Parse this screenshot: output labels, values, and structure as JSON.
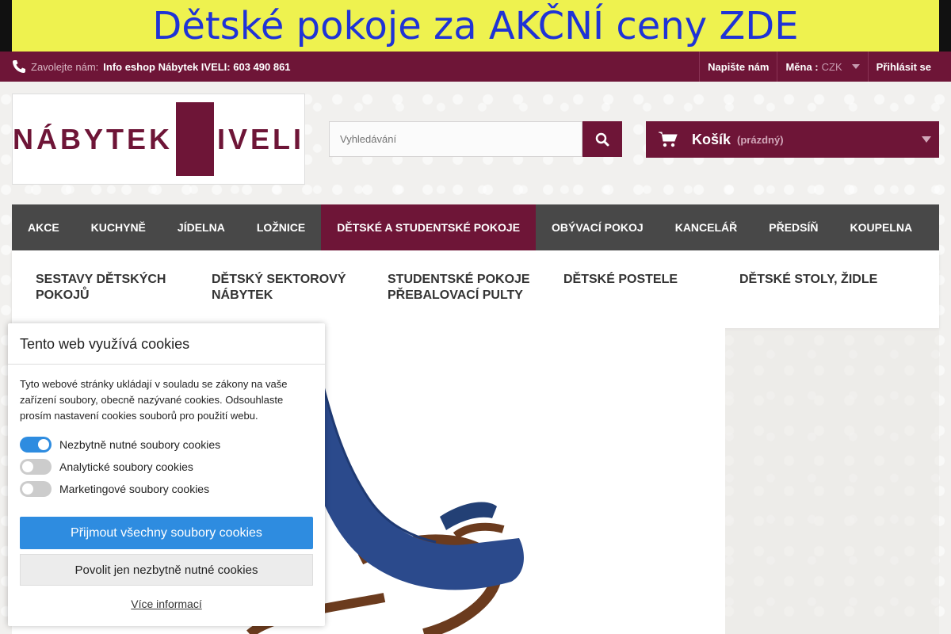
{
  "promo": {
    "text": "Dětské pokoje za AKČNÍ ceny ZDE"
  },
  "topbar": {
    "contact_label": "Zavolejte nám:",
    "contact_value": "Info eshop Nábytek IVELI: 603 490 861",
    "write_us": "Napište nám",
    "currency_label": "Měna :",
    "currency_value": "CZK",
    "login": "Přihlásit se"
  },
  "logo": {
    "left": "NÁBYTEK",
    "right": "IVELI"
  },
  "search": {
    "placeholder": "Vyhledávání"
  },
  "cart": {
    "label": "Košík",
    "status": "(prázdný)"
  },
  "menu": {
    "items": [
      "AKCE",
      "KUCHYNĚ",
      "JÍDELNA",
      "LOŽNICE",
      "DĚTSKÉ A STUDENTSKÉ POKOJE",
      "OBÝVACÍ POKOJ",
      "KANCELÁŘ",
      "PŘEDSÍŇ",
      "KOUPELNA"
    ]
  },
  "submenu": {
    "col1": "SESTAVY DĚTSKÝCH POKOJŮ",
    "col2": "DĚTSKÝ SEKTOROVÝ NÁBYTEK",
    "col3a": "STUDENTSKÉ POKOJE",
    "col3b": "PŘEBALOVACÍ PULTY",
    "col4": "DĚTSKÉ POSTELE",
    "col5": "DĚTSKÉ STOLY, ŽIDLE"
  },
  "cookie": {
    "title": "Tento web využívá cookies",
    "text": "Tyto webové stránky ukládají v souladu se zákony na vaše zařízení soubory, obecně nazývané cookies. Odsouhlaste prosím nastavení cookies souborů pro použití webu.",
    "opt_necessary": "Nezbytně nutné soubory cookies",
    "opt_analytics": "Analytické soubory cookies",
    "opt_marketing": "Marketingové soubory cookies",
    "accept_all": "Přijmout všechny soubory cookies",
    "only_necessary": "Povolit jen nezbytně nutné cookies",
    "more": "Více informací"
  },
  "colors": {
    "brand": "#6e1537",
    "promo_bg": "#eef24f",
    "promo_text": "#1f33d6",
    "accent": "#2e8ce0"
  }
}
